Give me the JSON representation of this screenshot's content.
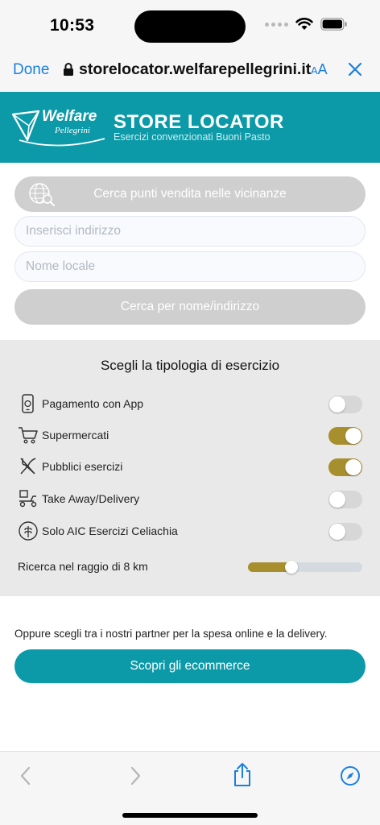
{
  "status": {
    "time": "10:53"
  },
  "browser": {
    "done_label": "Done",
    "url": "storelocator.welfarepellegrini.it",
    "aa_big": "A",
    "aa_small": "A"
  },
  "header": {
    "logo_word": "Welfare",
    "logo_sub": "Pellegrini",
    "title": "STORE LOCATOR",
    "subtitle": "Esercizi convenzionati Buoni Pasto"
  },
  "search": {
    "nearby_label": "Cerca punti vendita nelle vicinanze",
    "address_placeholder": "Inserisci indirizzo",
    "name_placeholder": "Nome locale",
    "search_label": "Cerca per nome/indirizzo"
  },
  "filters": {
    "title": "Scegli la tipologia di esercizio",
    "items": [
      {
        "label": "Pagamento con App",
        "icon": "phone-payment-icon",
        "enabled": false
      },
      {
        "label": "Supermercati",
        "icon": "shopping-cart-icon",
        "enabled": true
      },
      {
        "label": "Pubblici esercizi",
        "icon": "fork-knife-icon",
        "enabled": true
      },
      {
        "label": "Take Away/Delivery",
        "icon": "delivery-scooter-icon",
        "enabled": false
      },
      {
        "label": "Solo AIC Esercizi Celiachia",
        "icon": "gluten-free-icon",
        "enabled": false
      }
    ],
    "radius_label": "Ricerca nel raggio di 8 km",
    "radius_fraction": 0.38
  },
  "partners": {
    "text": "Oppure scegli tra i nostri partner per la spesa online e la delivery.",
    "button_label": "Scopri gli ecommerce"
  },
  "colors": {
    "brand_teal": "#0c9aa8",
    "toggle_on": "#a88f2e",
    "ios_blue": "#1a7fe0"
  }
}
